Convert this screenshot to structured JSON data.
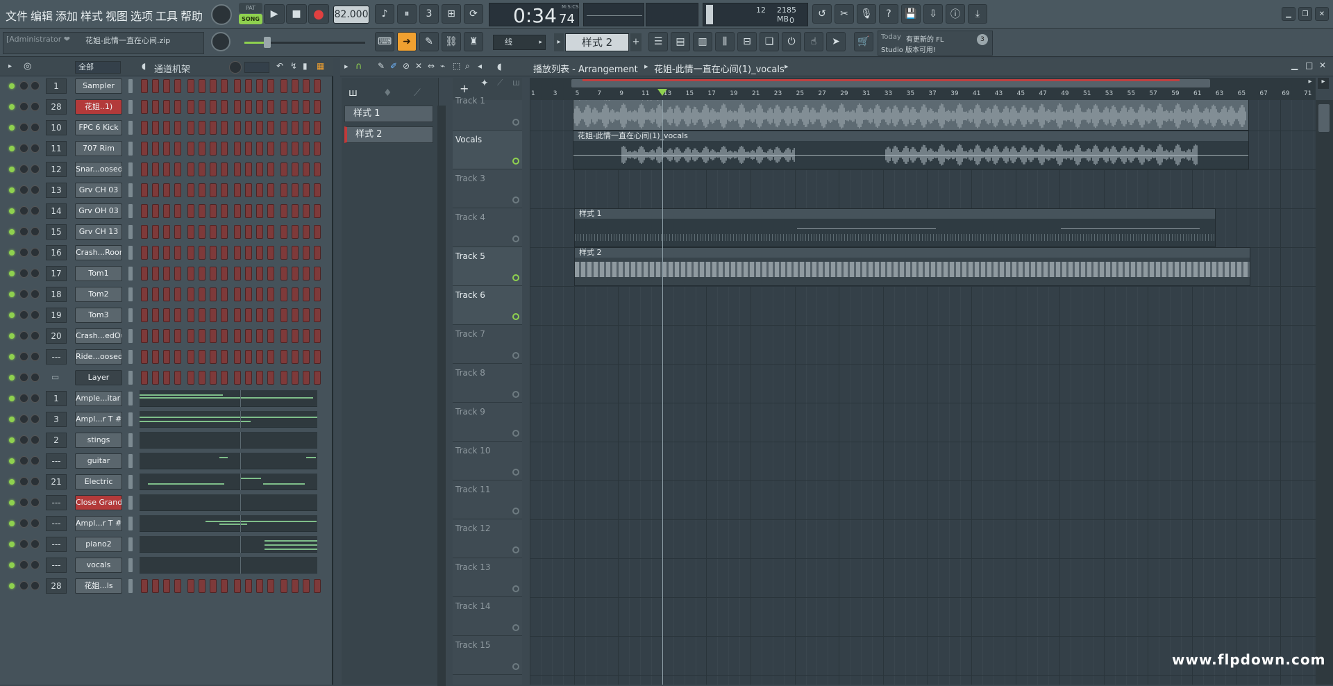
{
  "menu": {
    "file": "文件",
    "edit": "编辑",
    "add": "添加",
    "patterns": "样式",
    "view": "视图",
    "options": "选项",
    "tools": "工具",
    "help": "帮助"
  },
  "transport": {
    "mode_pat": "PAT",
    "mode_song": "SONG",
    "tempo": "82.000",
    "time_main": "0:34",
    "time_sub": "74",
    "time_unit": "M:S:CS"
  },
  "monitor": {
    "voices": "12",
    "memory": "2185 MB",
    "cpu": "0"
  },
  "project": {
    "user": "[Administrator ❤",
    "file": "花姐-此情一直在心间.zip"
  },
  "snap": {
    "label": "线"
  },
  "pattern_selector": {
    "label": "样式 2"
  },
  "news": {
    "when": "Today",
    "text1": "有更新的 FL",
    "text2": "Studio 版本可用!",
    "badge": "3"
  },
  "channel_rack": {
    "filter": "全部",
    "title": "通道机架"
  },
  "channels": [
    {
      "num": "1",
      "name": "Sampler",
      "style": "normal"
    },
    {
      "num": "28",
      "name": "花姐..1)",
      "style": "red"
    },
    {
      "num": "10",
      "name": "FPC 6 Kick",
      "style": "normal"
    },
    {
      "num": "11",
      "name": "707 Rim",
      "style": "normal"
    },
    {
      "num": "12",
      "name": "Snar...oosed",
      "style": "normal"
    },
    {
      "num": "13",
      "name": "Grv CH 03",
      "style": "normal"
    },
    {
      "num": "14",
      "name": "Grv OH 03",
      "style": "normal"
    },
    {
      "num": "15",
      "name": "Grv CH 13",
      "style": "normal"
    },
    {
      "num": "16",
      "name": "Crash...Room",
      "style": "normal"
    },
    {
      "num": "17",
      "name": "Tom1",
      "style": "normal"
    },
    {
      "num": "18",
      "name": "Tom2",
      "style": "normal"
    },
    {
      "num": "19",
      "name": "Tom3",
      "style": "normal"
    },
    {
      "num": "20",
      "name": "Crash...edOut",
      "style": "normal"
    },
    {
      "num": "---",
      "name": "Ride...oosed",
      "style": "normal"
    },
    {
      "num": "",
      "name": "Layer",
      "style": "dark"
    },
    {
      "num": "1",
      "name": "Ample...itar T",
      "style": "normal"
    },
    {
      "num": "3",
      "name": "Ampl...r T #2",
      "style": "normal"
    },
    {
      "num": "2",
      "name": "stings",
      "style": "normal"
    },
    {
      "num": "---",
      "name": "guitar",
      "style": "normal"
    },
    {
      "num": "21",
      "name": "Electric",
      "style": "normal"
    },
    {
      "num": "---",
      "name": "Close Grand",
      "style": "red"
    },
    {
      "num": "---",
      "name": "Ampl...r T #3",
      "style": "normal"
    },
    {
      "num": "---",
      "name": "piano2",
      "style": "normal"
    },
    {
      "num": "---",
      "name": "vocals",
      "style": "normal"
    },
    {
      "num": "28",
      "name": "花姐...ls",
      "style": "normal"
    }
  ],
  "playlist": {
    "title": "播放列表 - Arrangement",
    "crumb": "花姐-此情一直在心间(1)_vocals"
  },
  "patterns": [
    {
      "name": "样式 1"
    },
    {
      "name": "样式 2"
    }
  ],
  "tracks": [
    {
      "name": "Track 1",
      "active": false
    },
    {
      "name": "Vocals",
      "active": true
    },
    {
      "name": "Track 3",
      "active": false
    },
    {
      "name": "Track 4",
      "active": false
    },
    {
      "name": "Track 5",
      "active": true
    },
    {
      "name": "Track 6",
      "active": true
    },
    {
      "name": "Track 7",
      "active": false
    },
    {
      "name": "Track 8",
      "active": false
    },
    {
      "name": "Track 9",
      "active": false
    },
    {
      "name": "Track 10",
      "active": false
    },
    {
      "name": "Track 11",
      "active": false
    },
    {
      "name": "Track 12",
      "active": false
    },
    {
      "name": "Track 13",
      "active": false
    },
    {
      "name": "Track 14",
      "active": false
    },
    {
      "name": "Track 15",
      "active": false
    }
  ],
  "ruler_marks": [
    "1",
    "3",
    "5",
    "7",
    "9",
    "11",
    "13",
    "15",
    "17",
    "19",
    "21",
    "23",
    "25",
    "27",
    "29",
    "31",
    "33",
    "35",
    "37",
    "39",
    "41",
    "43",
    "45",
    "47",
    "49",
    "51",
    "53",
    "55",
    "57",
    "59",
    "61",
    "63",
    "65",
    "67",
    "69",
    "71"
  ],
  "clips": {
    "audio1": "花姐-此情一直在心间(1)",
    "vocals": "花姐-此情一直在心间(1)_vocals",
    "pat1": "样式 1",
    "pat2": "样式 2"
  },
  "watermark": "www.flpdown.com",
  "colors": {
    "accent_green": "#8fd14f",
    "step_red": "#7e3a3a",
    "grid_bg": "#344048"
  }
}
